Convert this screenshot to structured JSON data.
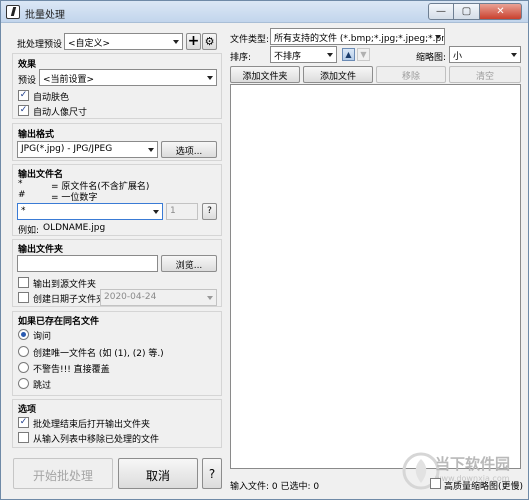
{
  "window": {
    "title": "批量处理",
    "minimize_glyph": "—",
    "maximize_glyph": "▢",
    "close_glyph": "✕"
  },
  "preset": {
    "label": "批处理预设",
    "value": "<自定义>",
    "add_glyph": "+",
    "settings_glyph": "⚙"
  },
  "effects": {
    "title": "效果",
    "preset_label": "预设",
    "preset_value": "<当前设置>",
    "auto_color_label": "自动肤色",
    "auto_color_checked": true,
    "auto_size_label": "自动人像尺寸",
    "auto_size_checked": true
  },
  "output_format": {
    "title": "输出格式",
    "value": "JPG(*.jpg) - JPG/JPEG",
    "options_label": "选项..."
  },
  "output_name": {
    "title": "输出文件名",
    "legend": [
      {
        "symbol": "*",
        "desc": "= 原文件名(不含扩展名)"
      },
      {
        "symbol": "#",
        "desc": "= 一位数字"
      }
    ],
    "pattern_value": "*",
    "number_value": "1",
    "help_label": "?",
    "example_label": "例如:",
    "example_value": "OLDNAME.jpg"
  },
  "output_folder": {
    "title": "输出文件夹",
    "path_value": "",
    "browse_label": "浏览...",
    "to_source_label": "输出到源文件夹",
    "to_source_checked": false,
    "date_sub_label": "创建日期子文件夹",
    "date_sub_checked": false,
    "date_value": "2020-04-24"
  },
  "exists": {
    "title": "如果已存在同名文件",
    "selected_index": 0,
    "options": [
      "询问",
      "创建唯一文件名 (如 (1), (2) 等.)",
      "不警告!!! 直接覆盖",
      "跳过"
    ]
  },
  "options": {
    "title": "选项",
    "open_after_label": "批处理结束后打开输出文件夹",
    "open_after_checked": true,
    "remove_done_label": "从输入列表中移除已处理的文件",
    "remove_done_checked": false
  },
  "footer": {
    "start_label": "开始批处理",
    "cancel_label": "取消",
    "help_label": "?"
  },
  "right": {
    "filetype_label": "文件类型:",
    "filetype_value": "所有支持的文件 (*.bmp;*.jpg;*.jpeg;*.png;*",
    "sort_label": "排序:",
    "sort_value": "不排序",
    "sort_up_glyph": "▲",
    "sort_down_glyph": "▼",
    "thumb_label": "缩略图:",
    "thumb_value": "小",
    "add_folder_label": "添加文件夹",
    "add_file_label": "添加文件",
    "remove_label": "移除",
    "clear_label": "清空",
    "status_text": "输入文件: 0  已选中: 0",
    "hq_thumb_label": "高质量缩略图(更慢)",
    "hq_thumb_checked": false
  },
  "watermark": {
    "title": "当下软件园",
    "subtitle": "www.downxia.com"
  }
}
